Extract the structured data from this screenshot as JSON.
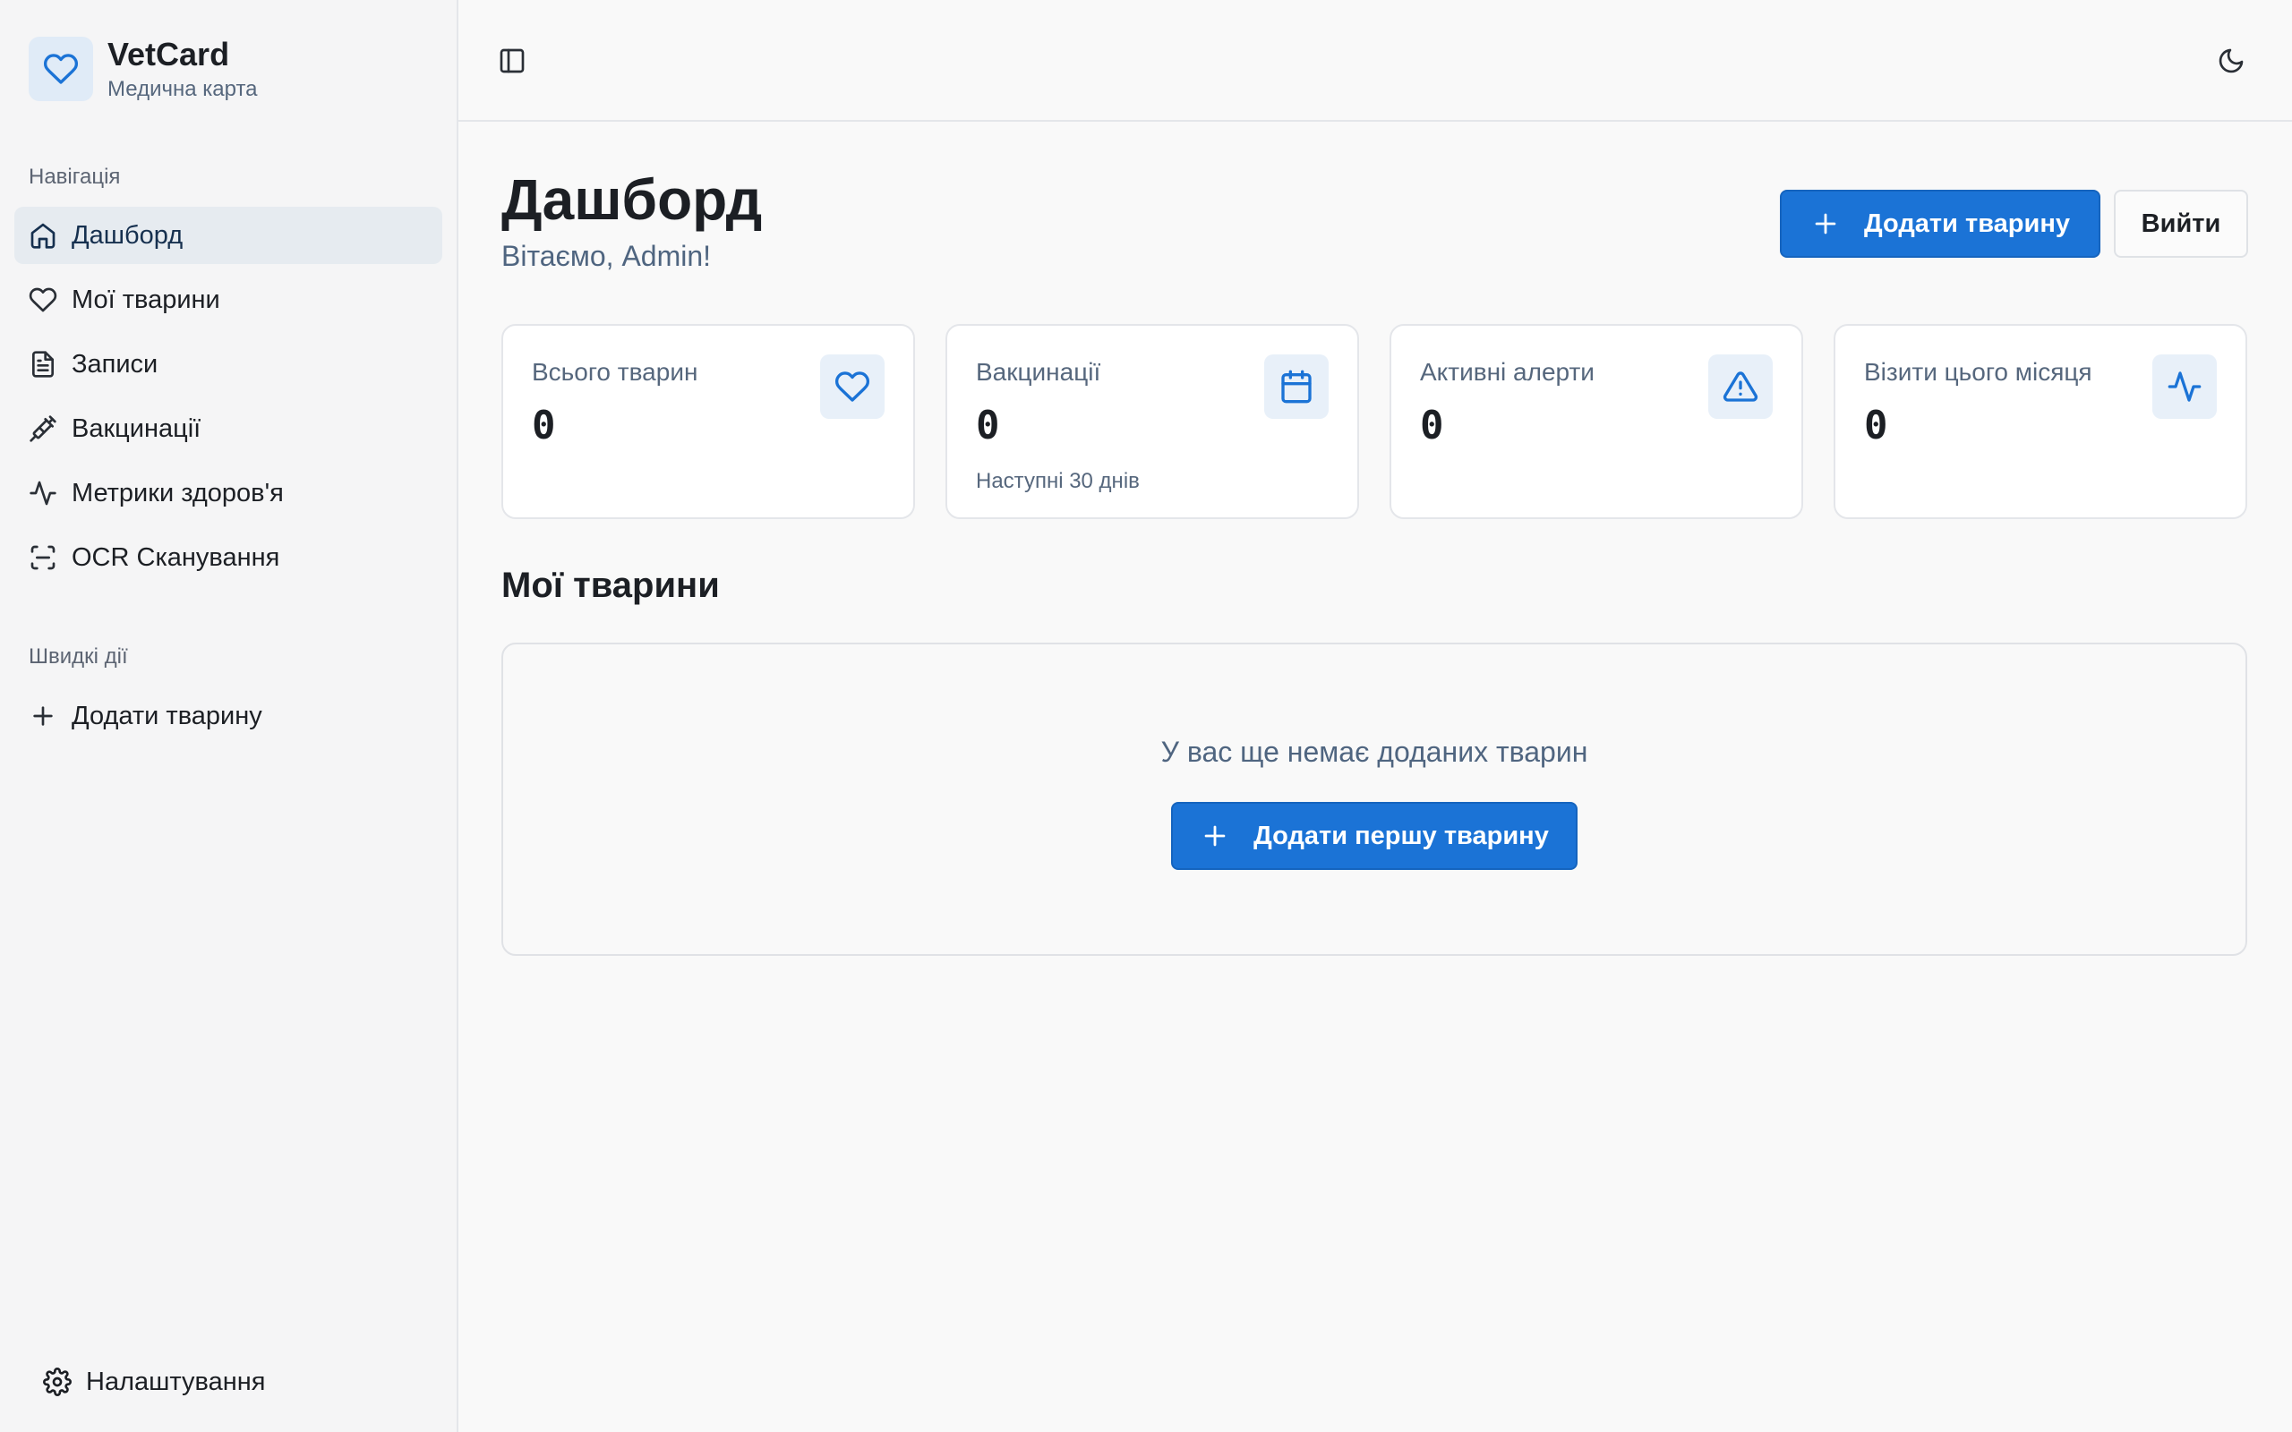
{
  "app": {
    "name": "VetCard",
    "subtitle": "Медична карта"
  },
  "sidebar": {
    "nav_label": "Навігація",
    "items": [
      {
        "label": "Дашборд",
        "icon": "home-icon",
        "active": true
      },
      {
        "label": "Мої тварини",
        "icon": "heart-icon"
      },
      {
        "label": "Записи",
        "icon": "document-icon"
      },
      {
        "label": "Вакцинації",
        "icon": "syringe-icon"
      },
      {
        "label": "Метрики здоров'я",
        "icon": "activity-icon"
      },
      {
        "label": "OCR Сканування",
        "icon": "scan-icon"
      }
    ],
    "quick_label": "Швидкі дії",
    "quick_items": [
      {
        "label": "Додати тварину",
        "icon": "plus-icon"
      }
    ],
    "settings_label": "Налаштування"
  },
  "header": {
    "sidebar_toggle_icon": "panel-left-icon",
    "theme_icon": "moon-icon"
  },
  "main": {
    "title": "Дашборд",
    "greeting": "Вітаємо, Admin!",
    "add_pet_button": "Додати тварину",
    "logout_button": "Вийти",
    "stats": [
      {
        "label": "Всього тварин",
        "value": "0",
        "note": "",
        "icon": "heart-icon"
      },
      {
        "label": "Вакцинації",
        "value": "0",
        "note": "Наступні 30 днів",
        "icon": "calendar-icon"
      },
      {
        "label": "Активні алерти",
        "value": "0",
        "note": "",
        "icon": "alert-triangle-icon"
      },
      {
        "label": "Візити цього місяця",
        "value": "0",
        "note": "",
        "icon": "activity-icon"
      }
    ],
    "pets_section_title": "Мої тварини",
    "empty_text": "У вас ще немає доданих тварин",
    "add_first_button": "Додати першу тварину"
  },
  "colors": {
    "accent": "#1b73d6",
    "accent_bg": "#e8f0f9",
    "sidebar_bg": "#f5f5f6",
    "page_bg": "#f9f9f9"
  }
}
